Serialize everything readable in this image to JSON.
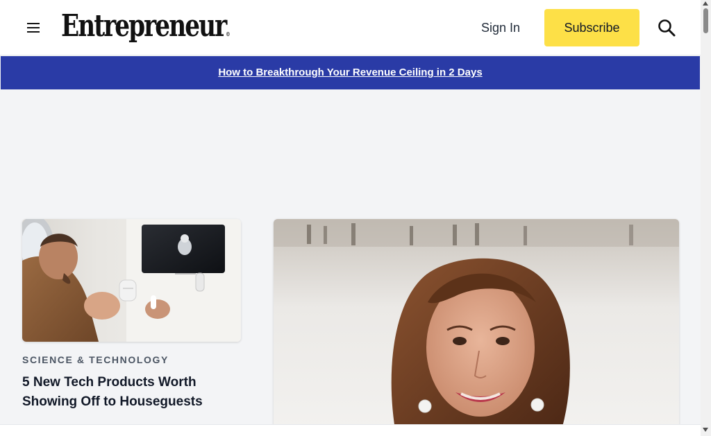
{
  "header": {
    "logo_text": "Entrepreneur",
    "logo_mark": "®",
    "signin_label": "Sign In",
    "subscribe_label": "Subscribe",
    "menu_icon": "hamburger-menu-icon",
    "search_icon": "search-icon"
  },
  "banner": {
    "link_text": "How to Breakthrough Your Revenue Ceiling in 2 Days "
  },
  "articles": [
    {
      "category": "SCIENCE & TECHNOLOGY",
      "headline": "5 New Tech Products Worth Showing Off to Houseguests",
      "image": "airplane-passenger-earbuds-photo"
    },
    {
      "image": "smiling-woman-portrait-photo"
    }
  ],
  "colors": {
    "banner_bg": "#2a3ba6",
    "subscribe_bg": "#fde047",
    "page_bg": "#f3f4f6"
  }
}
